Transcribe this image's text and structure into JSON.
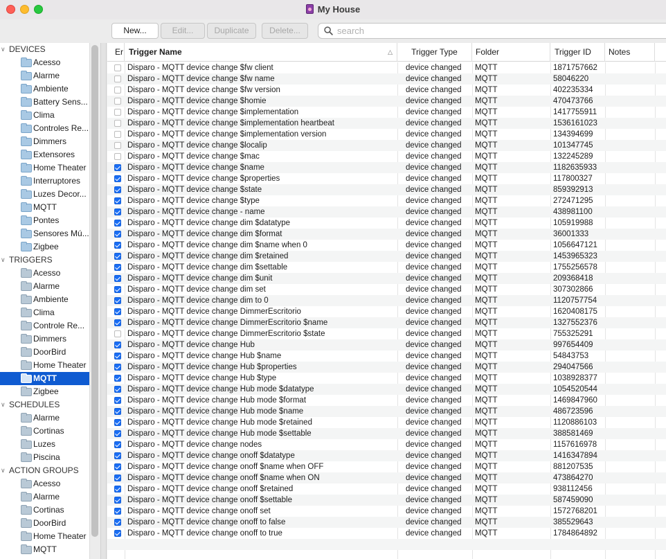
{
  "window": {
    "title": "My House"
  },
  "toolbar": {
    "new_label": "New...",
    "edit_label": "Edit...",
    "duplicate_label": "Duplicate",
    "delete_label": "Delete...",
    "search_placeholder": "search"
  },
  "sidebar": {
    "sections": [
      {
        "title": "DEVICES",
        "items": [
          "Acesso",
          "Alarme",
          "Ambiente",
          "Battery Sens...",
          "Clima",
          "Controles Re...",
          "Dimmers",
          "Extensores",
          "Home Theater",
          "Interruptores",
          "Luzes Decor...",
          "MQTT",
          "Pontes",
          "Sensores Mú...",
          "Zigbee"
        ]
      },
      {
        "title": "TRIGGERS",
        "items": [
          "Acesso",
          "Alarme",
          "Ambiente",
          "Clima",
          "Controle Re...",
          "Dimmers",
          "DoorBird",
          "Home Theater",
          "MQTT",
          "Zigbee"
        ]
      },
      {
        "title": "SCHEDULES",
        "items": [
          "Alarme",
          "Cortinas",
          "Luzes",
          "Piscina"
        ]
      },
      {
        "title": "ACTION GROUPS",
        "items": [
          "Acesso",
          "Alarme",
          "Cortinas",
          "DoorBird",
          "Home Theater",
          "MQTT"
        ]
      }
    ],
    "selected": {
      "section": "TRIGGERS",
      "item": "MQTT"
    }
  },
  "table": {
    "columns": {
      "enabled": "Er",
      "name": "Trigger Name",
      "type": "Trigger Type",
      "folder": "Folder",
      "id": "Trigger ID",
      "notes": "Notes"
    },
    "rows": [
      {
        "enabled": false,
        "name": "Disparo - MQTT device change $fw client",
        "type": "device changed",
        "folder": "MQTT",
        "id": "1871757662"
      },
      {
        "enabled": false,
        "name": "Disparo - MQTT device change $fw name",
        "type": "device changed",
        "folder": "MQTT",
        "id": "58046220"
      },
      {
        "enabled": false,
        "name": "Disparo - MQTT device change $fw version",
        "type": "device changed",
        "folder": "MQTT",
        "id": "402235334"
      },
      {
        "enabled": false,
        "name": "Disparo - MQTT device change $homie",
        "type": "device changed",
        "folder": "MQTT",
        "id": "470473766"
      },
      {
        "enabled": false,
        "name": "Disparo - MQTT device change $implementation",
        "type": "device changed",
        "folder": "MQTT",
        "id": "1417755911"
      },
      {
        "enabled": false,
        "name": "Disparo - MQTT device change $implementation heartbeat",
        "type": "device changed",
        "folder": "MQTT",
        "id": "1536161023"
      },
      {
        "enabled": false,
        "name": "Disparo - MQTT device change $implementation version",
        "type": "device changed",
        "folder": "MQTT",
        "id": "134394699"
      },
      {
        "enabled": false,
        "name": "Disparo - MQTT device change $localip",
        "type": "device changed",
        "folder": "MQTT",
        "id": "101347745"
      },
      {
        "enabled": false,
        "name": "Disparo - MQTT device change $mac",
        "type": "device changed",
        "folder": "MQTT",
        "id": "132245289"
      },
      {
        "enabled": true,
        "name": "Disparo - MQTT device change $name",
        "type": "device changed",
        "folder": "MQTT",
        "id": "1182635933"
      },
      {
        "enabled": true,
        "name": "Disparo - MQTT device change $properties",
        "type": "device changed",
        "folder": "MQTT",
        "id": "117800327"
      },
      {
        "enabled": true,
        "name": "Disparo - MQTT device change $state",
        "type": "device changed",
        "folder": "MQTT",
        "id": "859392913"
      },
      {
        "enabled": true,
        "name": "Disparo - MQTT device change $type",
        "type": "device changed",
        "folder": "MQTT",
        "id": "272471295"
      },
      {
        "enabled": true,
        "name": "Disparo - MQTT device change - name",
        "type": "device changed",
        "folder": "MQTT",
        "id": "438981100"
      },
      {
        "enabled": true,
        "name": "Disparo - MQTT device change dim $datatype",
        "type": "device changed",
        "folder": "MQTT",
        "id": "105919988"
      },
      {
        "enabled": true,
        "name": "Disparo - MQTT device change dim $format",
        "type": "device changed",
        "folder": "MQTT",
        "id": "36001333"
      },
      {
        "enabled": true,
        "name": "Disparo - MQTT device change dim $name when 0",
        "type": "device changed",
        "folder": "MQTT",
        "id": "1056647121"
      },
      {
        "enabled": true,
        "name": "Disparo - MQTT device change dim $retained",
        "type": "device changed",
        "folder": "MQTT",
        "id": "1453965323"
      },
      {
        "enabled": true,
        "name": "Disparo - MQTT device change dim $settable",
        "type": "device changed",
        "folder": "MQTT",
        "id": "1755256578"
      },
      {
        "enabled": true,
        "name": "Disparo - MQTT device change dim $unit",
        "type": "device changed",
        "folder": "MQTT",
        "id": "209368418"
      },
      {
        "enabled": true,
        "name": "Disparo - MQTT device change dim set",
        "type": "device changed",
        "folder": "MQTT",
        "id": "307302866"
      },
      {
        "enabled": true,
        "name": "Disparo - MQTT device change dim to 0",
        "type": "device changed",
        "folder": "MQTT",
        "id": "1120757754"
      },
      {
        "enabled": true,
        "name": "Disparo - MQTT device change DimmerEscritorio",
        "type": "device changed",
        "folder": "MQTT",
        "id": "1620408175"
      },
      {
        "enabled": true,
        "name": "Disparo - MQTT device change DimmerEscritorio $name",
        "type": "device changed",
        "folder": "MQTT",
        "id": "1327552376"
      },
      {
        "enabled": false,
        "name": "Disparo - MQTT device change DimmerEscritorio $state",
        "type": "device changed",
        "folder": "MQTT",
        "id": "755325291"
      },
      {
        "enabled": true,
        "name": "Disparo - MQTT device change Hub",
        "type": "device changed",
        "folder": "MQTT",
        "id": "997654409"
      },
      {
        "enabled": true,
        "name": "Disparo - MQTT device change Hub $name",
        "type": "device changed",
        "folder": "MQTT",
        "id": "54843753"
      },
      {
        "enabled": true,
        "name": "Disparo - MQTT device change Hub $properties",
        "type": "device changed",
        "folder": "MQTT",
        "id": "294047566"
      },
      {
        "enabled": true,
        "name": "Disparo - MQTT device change Hub $type",
        "type": "device changed",
        "folder": "MQTT",
        "id": "1038928377"
      },
      {
        "enabled": true,
        "name": "Disparo - MQTT device change Hub mode $datatype",
        "type": "device changed",
        "folder": "MQTT",
        "id": "1054520544"
      },
      {
        "enabled": true,
        "name": "Disparo - MQTT device change Hub mode $format",
        "type": "device changed",
        "folder": "MQTT",
        "id": "1469847960"
      },
      {
        "enabled": true,
        "name": "Disparo - MQTT device change Hub mode $name",
        "type": "device changed",
        "folder": "MQTT",
        "id": "486723596"
      },
      {
        "enabled": true,
        "name": "Disparo - MQTT device change Hub mode $retained",
        "type": "device changed",
        "folder": "MQTT",
        "id": "1120886103"
      },
      {
        "enabled": true,
        "name": "Disparo - MQTT device change Hub mode $settable",
        "type": "device changed",
        "folder": "MQTT",
        "id": "388581469"
      },
      {
        "enabled": true,
        "name": "Disparo - MQTT device change nodes",
        "type": "device changed",
        "folder": "MQTT",
        "id": "1157616978"
      },
      {
        "enabled": true,
        "name": "Disparo - MQTT device change onoff $datatype",
        "type": "device changed",
        "folder": "MQTT",
        "id": "1416347894"
      },
      {
        "enabled": true,
        "name": "Disparo - MQTT device change onoff $name when OFF",
        "type": "device changed",
        "folder": "MQTT",
        "id": "881207535"
      },
      {
        "enabled": true,
        "name": "Disparo - MQTT device change onoff $name when ON",
        "type": "device changed",
        "folder": "MQTT",
        "id": "473864270"
      },
      {
        "enabled": true,
        "name": "Disparo - MQTT device change onoff $retained",
        "type": "device changed",
        "folder": "MQTT",
        "id": "938112456"
      },
      {
        "enabled": true,
        "name": "Disparo - MQTT device change onoff $settable",
        "type": "device changed",
        "folder": "MQTT",
        "id": "587459090"
      },
      {
        "enabled": true,
        "name": "Disparo - MQTT device change onoff set",
        "type": "device changed",
        "folder": "MQTT",
        "id": "1572768201"
      },
      {
        "enabled": true,
        "name": "Disparo - MQTT device change onoff to false",
        "type": "device changed",
        "folder": "MQTT",
        "id": "385529643"
      },
      {
        "enabled": true,
        "name": "Disparo - MQTT device change onoff to true",
        "type": "device changed",
        "folder": "MQTT",
        "id": "1784864892"
      }
    ]
  },
  "colors": {
    "selection": "#0f5bd1",
    "checkbox_on": "#1a6ef5"
  }
}
